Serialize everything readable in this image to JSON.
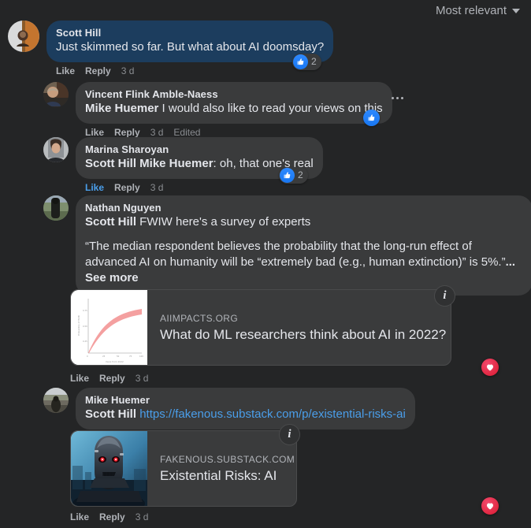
{
  "sort": {
    "label": "Most relevant",
    "icon": "chevron-down-icon"
  },
  "comments": [
    {
      "id": "scott-hill",
      "author": "Scott Hill",
      "avatar_alt": "scott-hill-avatar",
      "text": "Just skimmed so far. But what about AI doomsday?",
      "highlighted": true,
      "actions": {
        "like": "Like",
        "reply": "Reply",
        "time": "3 d"
      },
      "reaction": {
        "type": "like-thumb",
        "count": "2"
      }
    },
    {
      "id": "vincent-flink-amble-naess",
      "author": "Vincent Flink Amble-Naess",
      "avatar_alt": "vincent-flink-amble-naess-avatar",
      "mention": "Mike Huemer",
      "text": " I would also like to read your views on this",
      "actions": {
        "like": "Like",
        "reply": "Reply",
        "time": "3 d",
        "edited": "Edited"
      },
      "reaction": {
        "type": "like-thumb",
        "count": ""
      },
      "has_menu": true
    },
    {
      "id": "marina-sharoyan",
      "author": "Marina Sharoyan",
      "avatar_alt": "marina-sharoyan-avatar",
      "mention": "Scott Hill Mike Huemer",
      "text": ": oh, that one's real",
      "actions": {
        "like": "Like",
        "reply": "Reply",
        "time": "3 d"
      },
      "liked": true,
      "reaction": {
        "type": "like-thumb",
        "count": "2"
      }
    },
    {
      "id": "nathan-nguyen",
      "author": "Nathan Nguyen",
      "avatar_alt": "nathan-nguyen-avatar",
      "mention": "Scott Hill",
      "text": " FWIW here's a survey of experts",
      "quote": "“The median respondent believes the probability that the long-run effect of advanced AI on humanity will be “extremely bad (e.g., human extinction)” is 5%.”",
      "see_more": "... See more",
      "actions": {
        "like": "Like",
        "reply": "Reply",
        "time": "3 d"
      },
      "reaction": {
        "type": "love-heart"
      },
      "card": {
        "domain": "AIIMPACTS.ORG",
        "title": "What do ML researchers think about AI in 2022?",
        "thumbnail": "chart-thumbnail",
        "info_icon": "info-icon"
      }
    },
    {
      "id": "mike-huemer",
      "author": "Mike Huemer",
      "avatar_alt": "mike-huemer-avatar",
      "mention": "Scott Hill",
      "link": "https://fakenous.substack.com/p/existential-risks-ai",
      "actions": {
        "like": "Like",
        "reply": "Reply",
        "time": "3 d"
      },
      "reaction": {
        "type": "love-heart"
      },
      "card": {
        "domain": "FAKENOUS.SUBSTACK.COM",
        "title": "Existential Risks: AI",
        "thumbnail": "robot-thumbnail",
        "info_icon": "info-icon"
      }
    }
  ],
  "colors": {
    "page_bg": "#242526",
    "bubble_bg": "#3a3b3c",
    "highlight_bubble_bg": "#1c3d5e",
    "primary_text": "#e4e6eb",
    "secondary_text": "#b0b3b8",
    "link": "#4a9eea",
    "like_blue": "#1877f2",
    "love_red": "#e0253f"
  }
}
